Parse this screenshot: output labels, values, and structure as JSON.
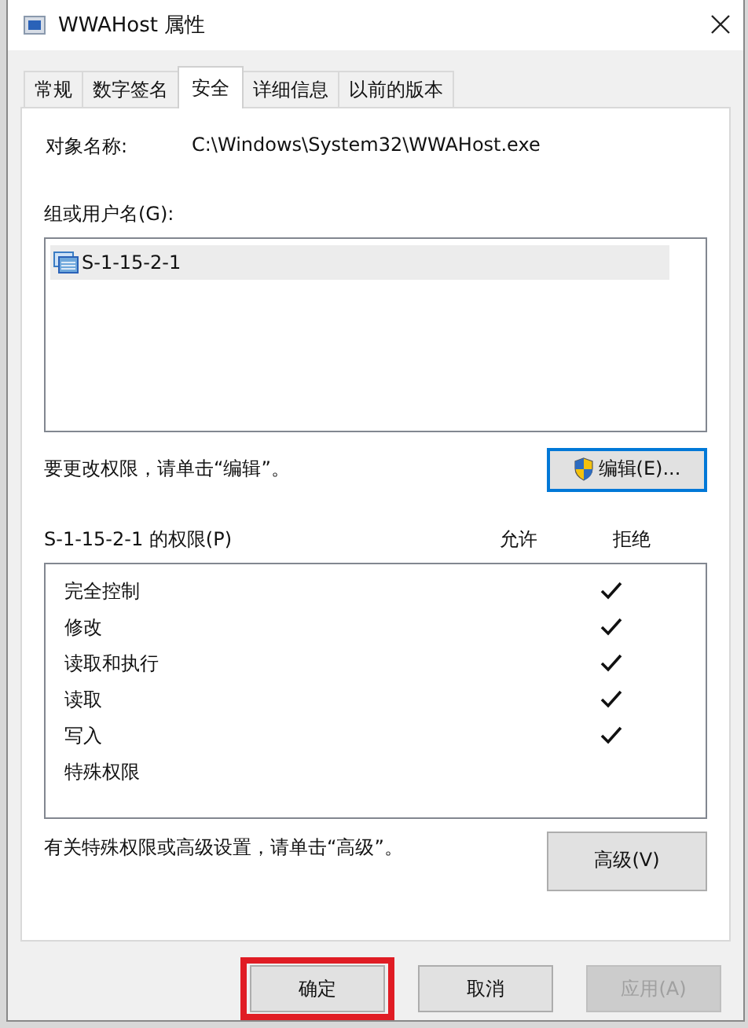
{
  "window": {
    "title": "WWAHost 属性"
  },
  "tabs": [
    {
      "label": "常规",
      "selected": false
    },
    {
      "label": "数字签名",
      "selected": false
    },
    {
      "label": "安全",
      "selected": true
    },
    {
      "label": "详细信息",
      "selected": false
    },
    {
      "label": "以前的版本",
      "selected": false
    }
  ],
  "object_name": {
    "label": "对象名称:",
    "value": "C:\\Windows\\System32\\WWAHost.exe"
  },
  "groups": {
    "label": "组或用户名(G):",
    "items": [
      {
        "name": "S-1-15-2-1",
        "selected": true
      }
    ]
  },
  "edit_hint": "要更改权限，请单击“编辑”。",
  "edit_button": {
    "label": "编辑(E)...",
    "focused": true
  },
  "permissions": {
    "label": "S-1-15-2-1 的权限(P)",
    "allow_header": "允许",
    "deny_header": "拒绝",
    "rows": [
      {
        "name": "完全控制",
        "allow": false,
        "deny": true
      },
      {
        "name": "修改",
        "allow": false,
        "deny": true
      },
      {
        "name": "读取和执行",
        "allow": false,
        "deny": true
      },
      {
        "name": "读取",
        "allow": false,
        "deny": true
      },
      {
        "name": "写入",
        "allow": false,
        "deny": true
      },
      {
        "name": "特殊权限",
        "allow": false,
        "deny": false
      }
    ]
  },
  "advanced_hint": "有关特殊权限或高级设置，请单击“高级”。",
  "advanced_button": {
    "label": "高级(V)",
    "focused": false
  },
  "buttons": [
    {
      "label": "确定",
      "disabled": false,
      "highlighted": true
    },
    {
      "label": "取消",
      "disabled": false,
      "highlighted": false
    },
    {
      "label": "应用(A)",
      "disabled": true,
      "highlighted": false
    }
  ]
}
